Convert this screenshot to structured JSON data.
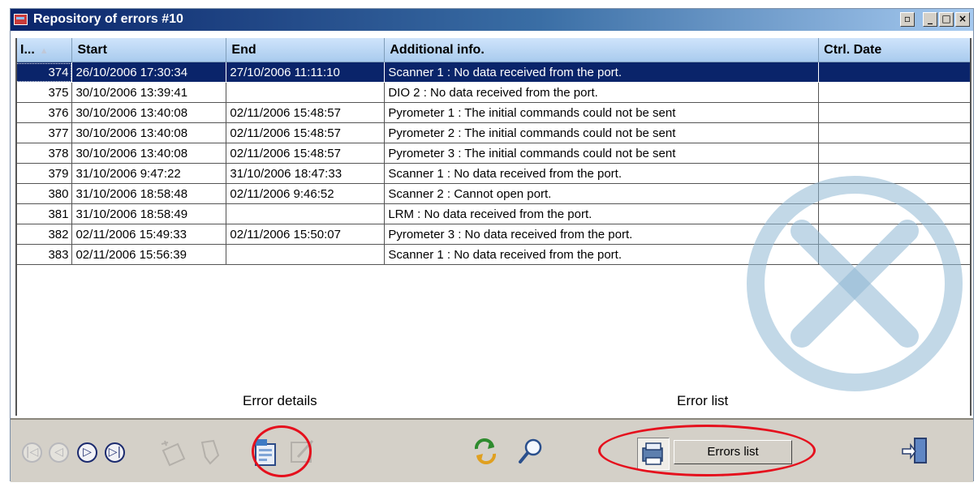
{
  "window": {
    "title": "Repository of errors #10",
    "controls": [
      "▫",
      "_",
      "□",
      "×"
    ]
  },
  "grid": {
    "columns": [
      "I...",
      "Start",
      "End",
      "Additional info.",
      "Ctrl. Date"
    ],
    "sort_indicator": "▲",
    "selected_id": "374",
    "rows": [
      {
        "id": "374",
        "start": "26/10/2006 17:30:34",
        "end": "27/10/2006 11:11:10",
        "info": "Scanner 1 : No data received from the port.",
        "ctrl": ""
      },
      {
        "id": "375",
        "start": "30/10/2006 13:39:41",
        "end": "",
        "info": "DIO 2 : No data received from the port.",
        "ctrl": ""
      },
      {
        "id": "376",
        "start": "30/10/2006 13:40:08",
        "end": "02/11/2006 15:48:57",
        "info": "Pyrometer 1 : The initial commands could not be sent",
        "ctrl": ""
      },
      {
        "id": "377",
        "start": "30/10/2006 13:40:08",
        "end": "02/11/2006 15:48:57",
        "info": "Pyrometer 2 : The initial commands could not be sent",
        "ctrl": ""
      },
      {
        "id": "378",
        "start": "30/10/2006 13:40:08",
        "end": "02/11/2006 15:48:57",
        "info": "Pyrometer 3 : The initial commands could not be sent",
        "ctrl": ""
      },
      {
        "id": "379",
        "start": "31/10/2006 9:47:22",
        "end": "31/10/2006 18:47:33",
        "info": "Scanner 1 : No data received from the port.",
        "ctrl": ""
      },
      {
        "id": "380",
        "start": "31/10/2006 18:58:48",
        "end": "02/11/2006 9:46:52",
        "info": "Scanner 2 : Cannot open port.",
        "ctrl": ""
      },
      {
        "id": "381",
        "start": "31/10/2006 18:58:49",
        "end": "",
        "info": "LRM : No data received from the port.",
        "ctrl": ""
      },
      {
        "id": "382",
        "start": "02/11/2006 15:49:33",
        "end": "02/11/2006 15:50:07",
        "info": "Pyrometer 3 : No data received from the port.",
        "ctrl": ""
      },
      {
        "id": "383",
        "start": "02/11/2006 15:56:39",
        "end": "",
        "info": "Scanner 1 : No data received from the port.",
        "ctrl": ""
      }
    ]
  },
  "captions": {
    "error_details": "Error details",
    "error_list": "Error list"
  },
  "toolbar": {
    "errors_list_label": "Errors list",
    "nav_glyphs": [
      "|◁",
      "◁",
      "▷",
      "▷|"
    ],
    "icons": [
      "first-record-icon",
      "previous-record-icon",
      "next-record-icon",
      "last-record-icon",
      "new-record-icon",
      "delete-record-icon",
      "error-details-icon",
      "edit-record-icon",
      "refresh-icon",
      "search-icon",
      "errors-list-icon",
      "exit-icon"
    ]
  },
  "colors": {
    "selection": "#0a246a",
    "header": "#b9d6f5",
    "highlight_ring": "#e5101d",
    "watermark": "#8fb8d4"
  }
}
